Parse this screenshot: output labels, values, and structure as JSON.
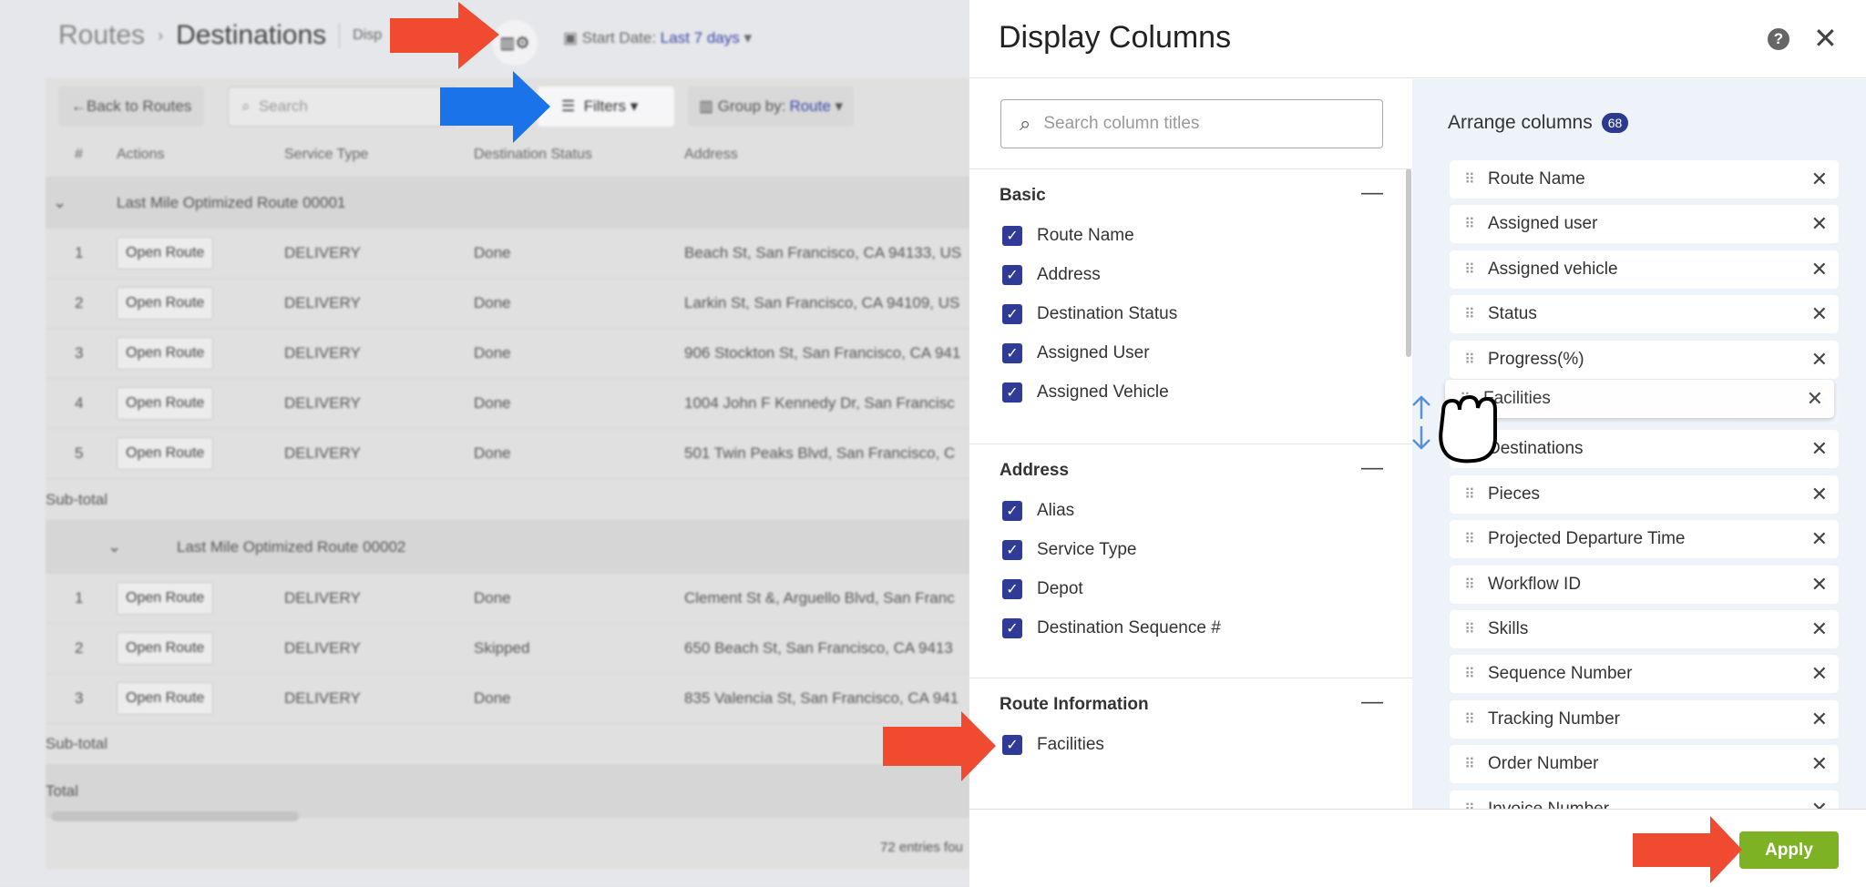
{
  "background": {
    "breadcrumb": {
      "parent": "Routes",
      "current": "Destinations",
      "truncated": "Disp"
    },
    "start_date": {
      "label": "Start Date:",
      "value": "Last 7 days"
    },
    "toolbar": {
      "back": "Back to Routes",
      "search_placeholder": "Search",
      "filters": "Filters",
      "group_label": "Group by:",
      "group_value": "Route"
    },
    "headers": [
      "#",
      "Actions",
      "Service Type",
      "Destination Status",
      "Address"
    ],
    "groups": [
      {
        "name": "Last Mile Optimized Route 00001",
        "rows": [
          [
            "1",
            "Open Route",
            "DELIVERY",
            "Done",
            "Beach St, San Francisco, CA 94133, US"
          ],
          [
            "2",
            "Open Route",
            "DELIVERY",
            "Done",
            "Larkin St, San Francisco, CA 94109, US"
          ],
          [
            "3",
            "Open Route",
            "DELIVERY",
            "Done",
            "906 Stockton St, San Francisco, CA 941"
          ],
          [
            "4",
            "Open Route",
            "DELIVERY",
            "Done",
            "1004 John F Kennedy Dr, San Francisc"
          ],
          [
            "5",
            "Open Route",
            "DELIVERY",
            "Done",
            "501 Twin Peaks Blvd, San Francisco, C"
          ]
        ]
      },
      {
        "name": "Last Mile Optimized Route 00002",
        "rows": [
          [
            "1",
            "Open Route",
            "DELIVERY",
            "Done",
            "Clement St &, Arguello Blvd, San Franc"
          ],
          [
            "2",
            "Open Route",
            "DELIVERY",
            "Skipped",
            "650 Beach St, San Francisco, CA 9413"
          ],
          [
            "3",
            "Open Route",
            "DELIVERY",
            "Done",
            "835 Valencia St, San Francisco, CA 941"
          ]
        ]
      }
    ],
    "subtotal": "Sub-total",
    "total": "Total",
    "entries": "72 entries fou"
  },
  "panel": {
    "title": "Display Columns",
    "search_placeholder": "Search column titles",
    "sections": [
      {
        "title": "Basic",
        "items": [
          "Route Name",
          "Address",
          "Destination Status",
          "Assigned User",
          "Assigned Vehicle"
        ]
      },
      {
        "title": "Address",
        "items": [
          "Alias",
          "Service Type",
          "Depot",
          "Destination Sequence #"
        ]
      },
      {
        "title": "Route Information",
        "items": [
          "Facilities"
        ]
      }
    ],
    "arrange_title": "Arrange columns",
    "arrange_count": "68",
    "arranged": [
      "Route Name",
      "Assigned user",
      "Assigned vehicle",
      "Status",
      "Progress(%)",
      "Facilities",
      "Destinations",
      "Pieces",
      "Projected Departure Time",
      "Workflow ID",
      "Skills",
      "Sequence Number",
      "Tracking Number",
      "Order Number",
      "Invoice Number"
    ],
    "dragging": "Facilities",
    "apply": "Apply"
  },
  "colors": {
    "accent": "#2f3b97",
    "apply": "#7cb224",
    "arrow_red": "#f04a30",
    "arrow_blue": "#1a73e8"
  }
}
